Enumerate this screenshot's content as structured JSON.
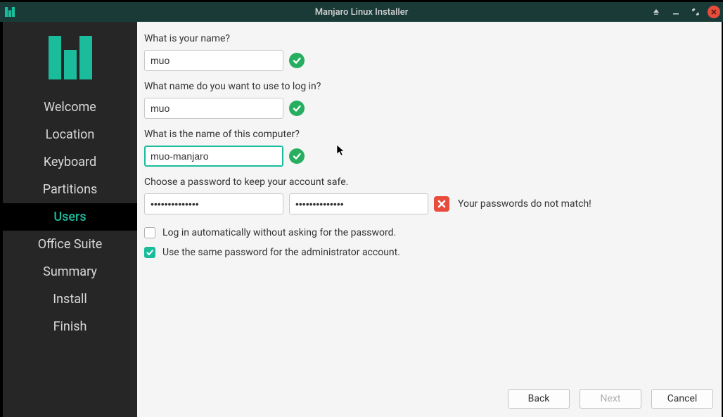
{
  "window": {
    "title": "Manjaro Linux Installer"
  },
  "sidebar": {
    "items": [
      {
        "label": "Welcome"
      },
      {
        "label": "Location"
      },
      {
        "label": "Keyboard"
      },
      {
        "label": "Partitions"
      },
      {
        "label": "Users"
      },
      {
        "label": "Office Suite"
      },
      {
        "label": "Summary"
      },
      {
        "label": "Install"
      },
      {
        "label": "Finish"
      }
    ],
    "active_index": 4
  },
  "form": {
    "name_label": "What is your name?",
    "name_value": "muo",
    "login_label": "What name do you want to use to log in?",
    "login_value": "muo",
    "host_label": "What is the name of this computer?",
    "host_value": "muo-manjaro",
    "pwd_label": "Choose a password to keep your account safe.",
    "pwd1_value": "••••••••••••••",
    "pwd2_value": "••••••••••••••",
    "pwd_error": "Your passwords do not match!",
    "autologin_label": "Log in automatically without asking for the password.",
    "autologin_checked": false,
    "samepwd_label": "Use the same password for the administrator account.",
    "samepwd_checked": true
  },
  "buttons": {
    "back": "Back",
    "next": "Next",
    "cancel": "Cancel"
  }
}
